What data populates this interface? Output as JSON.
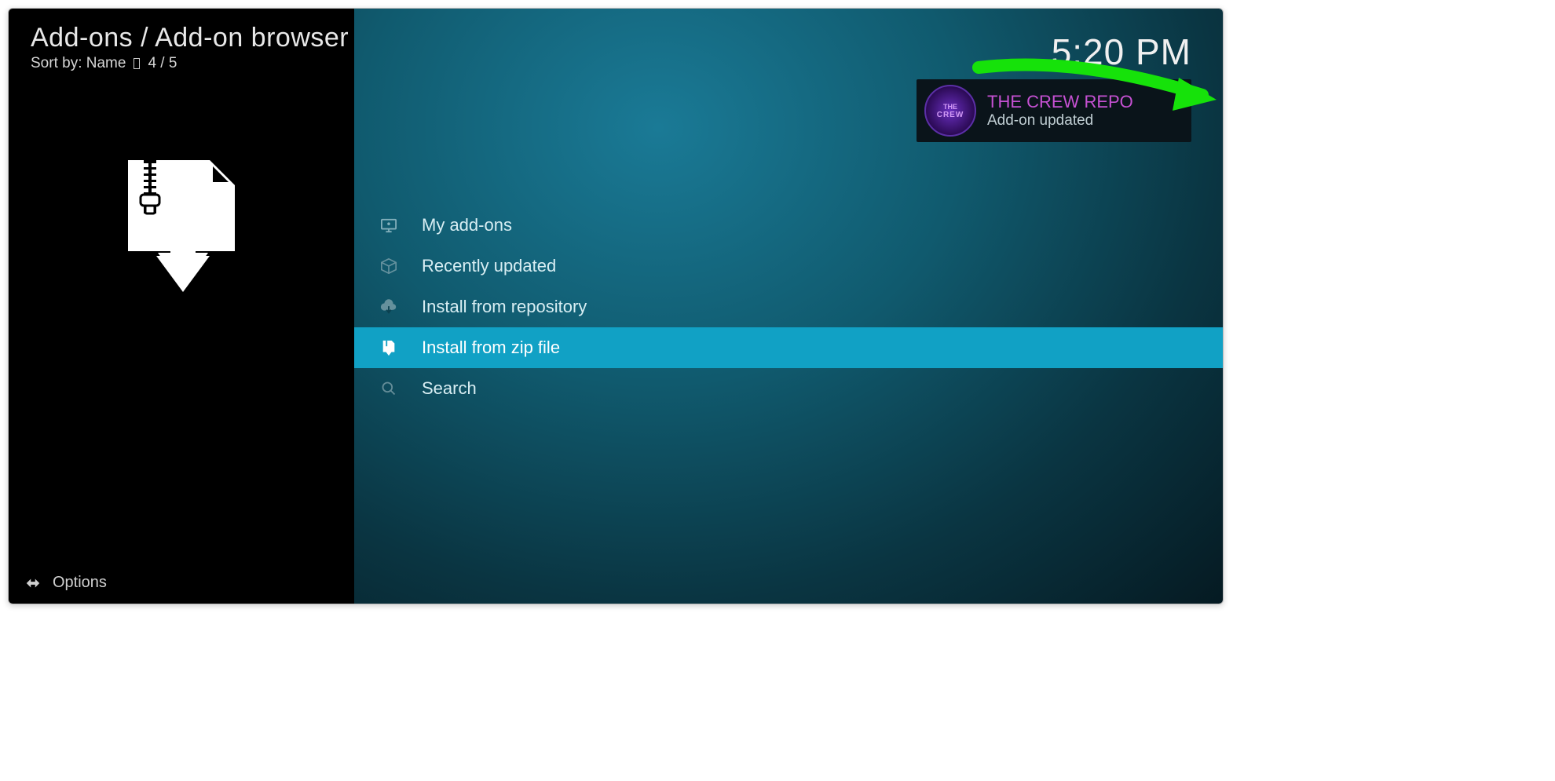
{
  "breadcrumb": "Add-ons / Add-on browser",
  "sort": {
    "label": "Sort by: Name",
    "position": "4 / 5"
  },
  "clock": "5:20 PM",
  "menu": {
    "items": [
      {
        "label": "My add-ons",
        "icon": "monitor-icon",
        "selected": false
      },
      {
        "label": "Recently updated",
        "icon": "box-icon",
        "selected": false
      },
      {
        "label": "Install from repository",
        "icon": "cloud-download-icon",
        "selected": false
      },
      {
        "label": "Install from zip file",
        "icon": "zip-download-icon",
        "selected": true
      },
      {
        "label": "Search",
        "icon": "search-icon",
        "selected": false
      }
    ]
  },
  "notification": {
    "title": "THE CREW REPO",
    "subtitle": "Add-on updated",
    "logo_top": "THE",
    "logo_bottom": "CREW"
  },
  "options_label": "Options"
}
